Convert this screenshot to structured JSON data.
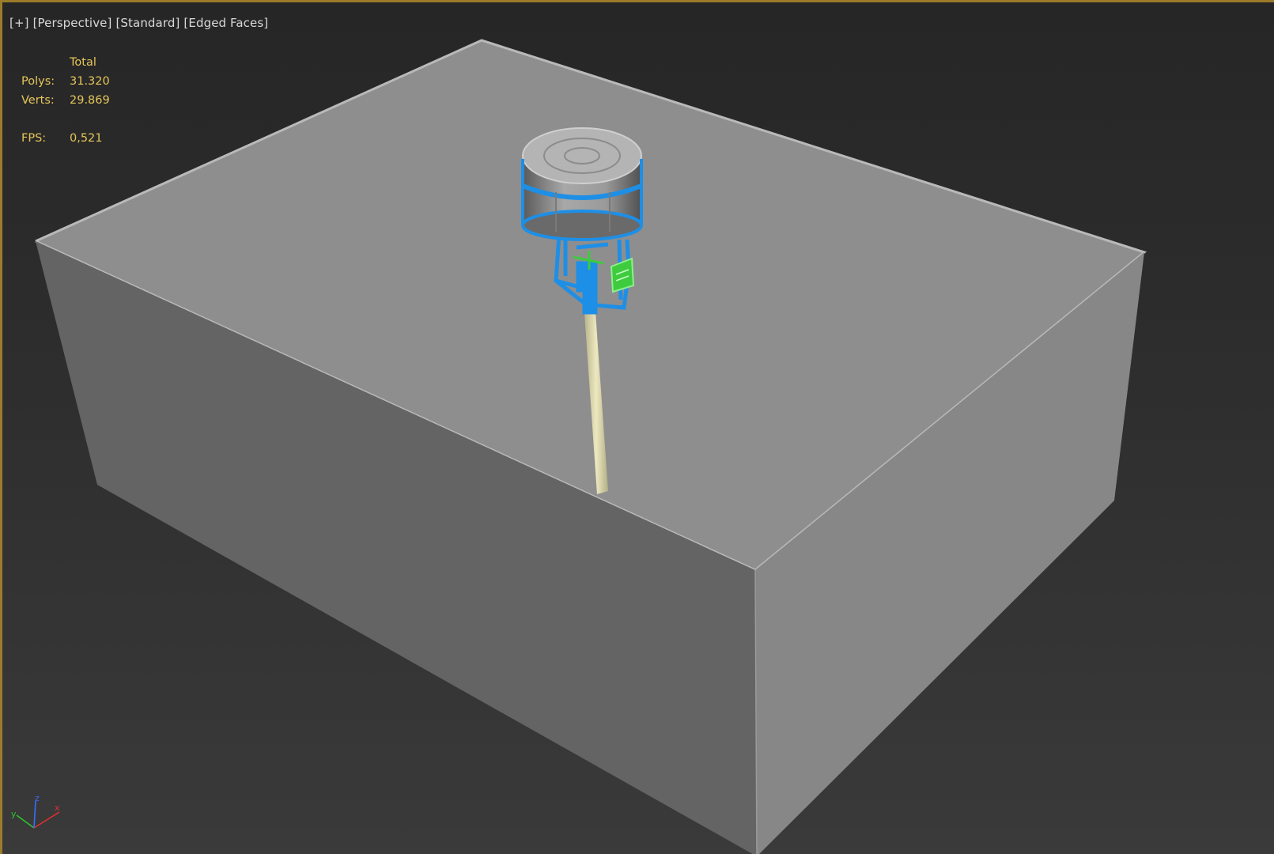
{
  "viewport": {
    "labels": {
      "plus": "[+]",
      "view": "[Perspective]",
      "shading": "[Standard]",
      "edges": "[Edged Faces]"
    },
    "stats": {
      "header": "Total",
      "polys_label": "Polys:",
      "polys_value": "31.320",
      "verts_label": "Verts:",
      "verts_value": "29.869",
      "fps_label": "FPS:",
      "fps_value": "0,521"
    },
    "axis": {
      "x": "x",
      "y": "y",
      "z": "z"
    }
  },
  "colors": {
    "accent_border": "#9c7c2a",
    "stats_text": "#e6c65a",
    "water": "#c9c79a",
    "selection_blue": "#1e8fe6",
    "selection_green": "#3ecb3e",
    "axis_x": "#e03030",
    "axis_y": "#30c030",
    "axis_z": "#3a6cff"
  }
}
